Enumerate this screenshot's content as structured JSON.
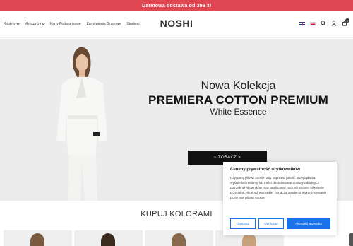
{
  "promo": {
    "text": "Darmowa dostawa od 399 zł"
  },
  "nav": {
    "items": [
      {
        "label": "Kobiety",
        "has_dropdown": true
      },
      {
        "label": "Mężczyźni",
        "has_dropdown": true
      },
      {
        "label": "Karty Podarunkowe",
        "has_dropdown": false
      },
      {
        "label": "Zamówienia Grupowe",
        "has_dropdown": false
      },
      {
        "label": "Studenci",
        "has_dropdown": false
      }
    ]
  },
  "logo": {
    "text": "NOSHI"
  },
  "header_icons": {
    "languages": [
      "en",
      "pl"
    ],
    "cart_count": "0"
  },
  "hero": {
    "subtitle": "Nowa Kolekcja",
    "title": "PREMIERA COTTON PREMIUM",
    "description": "White Essence",
    "cta_label": "< ZOBACZ >"
  },
  "section": {
    "title": "KUPUJ KOLORAMI"
  },
  "cookie": {
    "title": "Cenimy prywatność użytkowników",
    "body": "Używamy plików cookie, aby poprawić jakość przeglądania, wyświetlać reklamy lub treści dostosowane do indywidualnych potrzeb użytkowników oraz analizować ruch na stronie. Kliknięcie przycisku „Akceptuj wszystkie” oznacza zgodę na wykorzystywanie przez nas plików cookie.",
    "customize_label": "Dostosuj",
    "reject_label": "Odrzucać",
    "accept_label": "Akceptuj wszystko"
  },
  "colors": {
    "promo_bar": "#e14653",
    "accent_blue": "#1a73e8",
    "hero_bg": "#ececec"
  }
}
